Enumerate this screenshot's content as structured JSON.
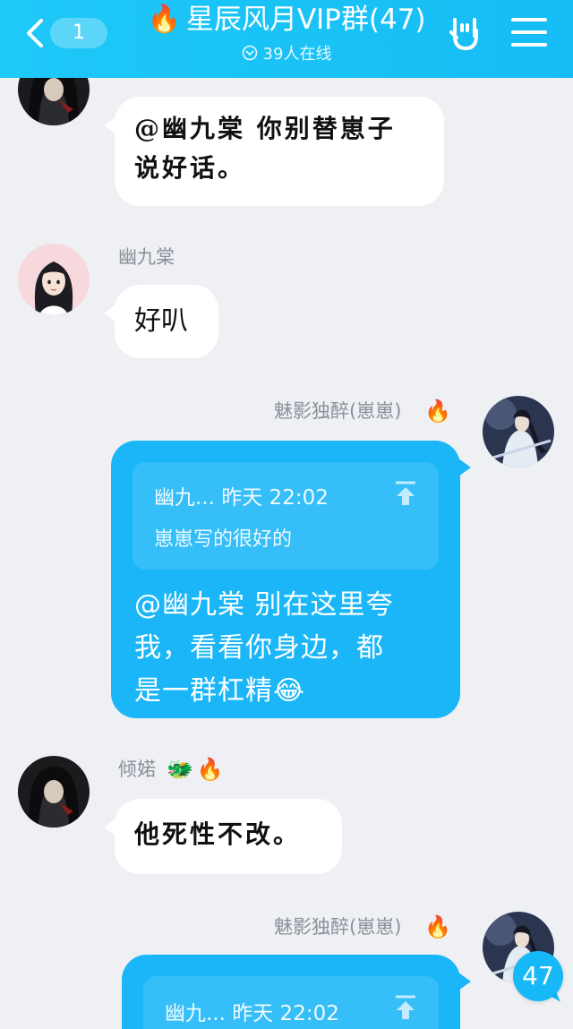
{
  "header": {
    "back_unread_count": "1",
    "title_emoji": "🔥",
    "title": "星辰风月VIP群(47)",
    "online_text": "39人在线"
  },
  "messages": [
    {
      "sender": "",
      "side": "left",
      "text_lines": [
        "@幽九棠 你别替崽子",
        "说好话。"
      ]
    },
    {
      "sender": "幽九棠",
      "side": "left",
      "text_lines": [
        "好叭"
      ]
    },
    {
      "sender": "魅影独醉(崽崽)",
      "side": "right",
      "badge": "🔥",
      "quote": {
        "meta": "幽九... 昨天 22:02",
        "text": "崽崽写的很好的"
      },
      "text_lines": [
        "@幽九棠 别在这里夸",
        "我，看看你身边，都",
        "是一群杠精😂"
      ]
    },
    {
      "sender": "倾婼",
      "side": "left",
      "badges": [
        "🐲",
        "🔥"
      ],
      "text_lines": [
        "他死性不改。"
      ]
    },
    {
      "sender": "魅影独醉(崽崽)",
      "side": "right",
      "badge": "🔥",
      "quote": {
        "meta": "幽九... 昨天 22:02"
      },
      "text_lines": []
    }
  ],
  "unread_floating_count": "47",
  "colors": {
    "header": "#1ec8f7",
    "bubble_blue": "#1ab6f8",
    "bubble_white": "#ffffff",
    "background": "#eef0f4",
    "name_gray": "#8a8f99"
  },
  "icons": {
    "back": "chevron-left-icon",
    "online": "online-status-icon",
    "rock": "rock-hand-icon",
    "menu": "menu-icon",
    "quote_jump": "jump-to-message-icon"
  }
}
